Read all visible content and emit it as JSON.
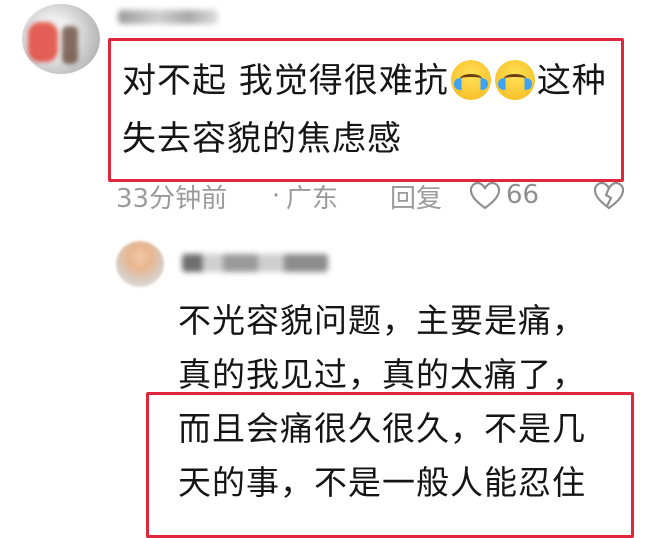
{
  "comment": {
    "text_line1_a": "对不起 我觉得很难抗",
    "emoji_1": "loudly-crying-face",
    "emoji_2": "loudly-crying-face",
    "text_line1_b": "这种",
    "text_line2": "失去容貌的焦虑感",
    "time": "33分钟前",
    "dot": "·",
    "location": "广东",
    "reply_label": "回复",
    "like_icon": "heart-outline-icon",
    "like_count": "66",
    "dislike_icon": "broken-heart-icon"
  },
  "reply": {
    "lines": [
      "不光容貌问题，主要是痛，",
      "真的我见过，真的太痛了，",
      "而且会痛很久很久，不是几",
      "天的事，不是一般人能忍住"
    ]
  },
  "highlight_color": "#e0263a",
  "meta_color": "#9b9b9b"
}
